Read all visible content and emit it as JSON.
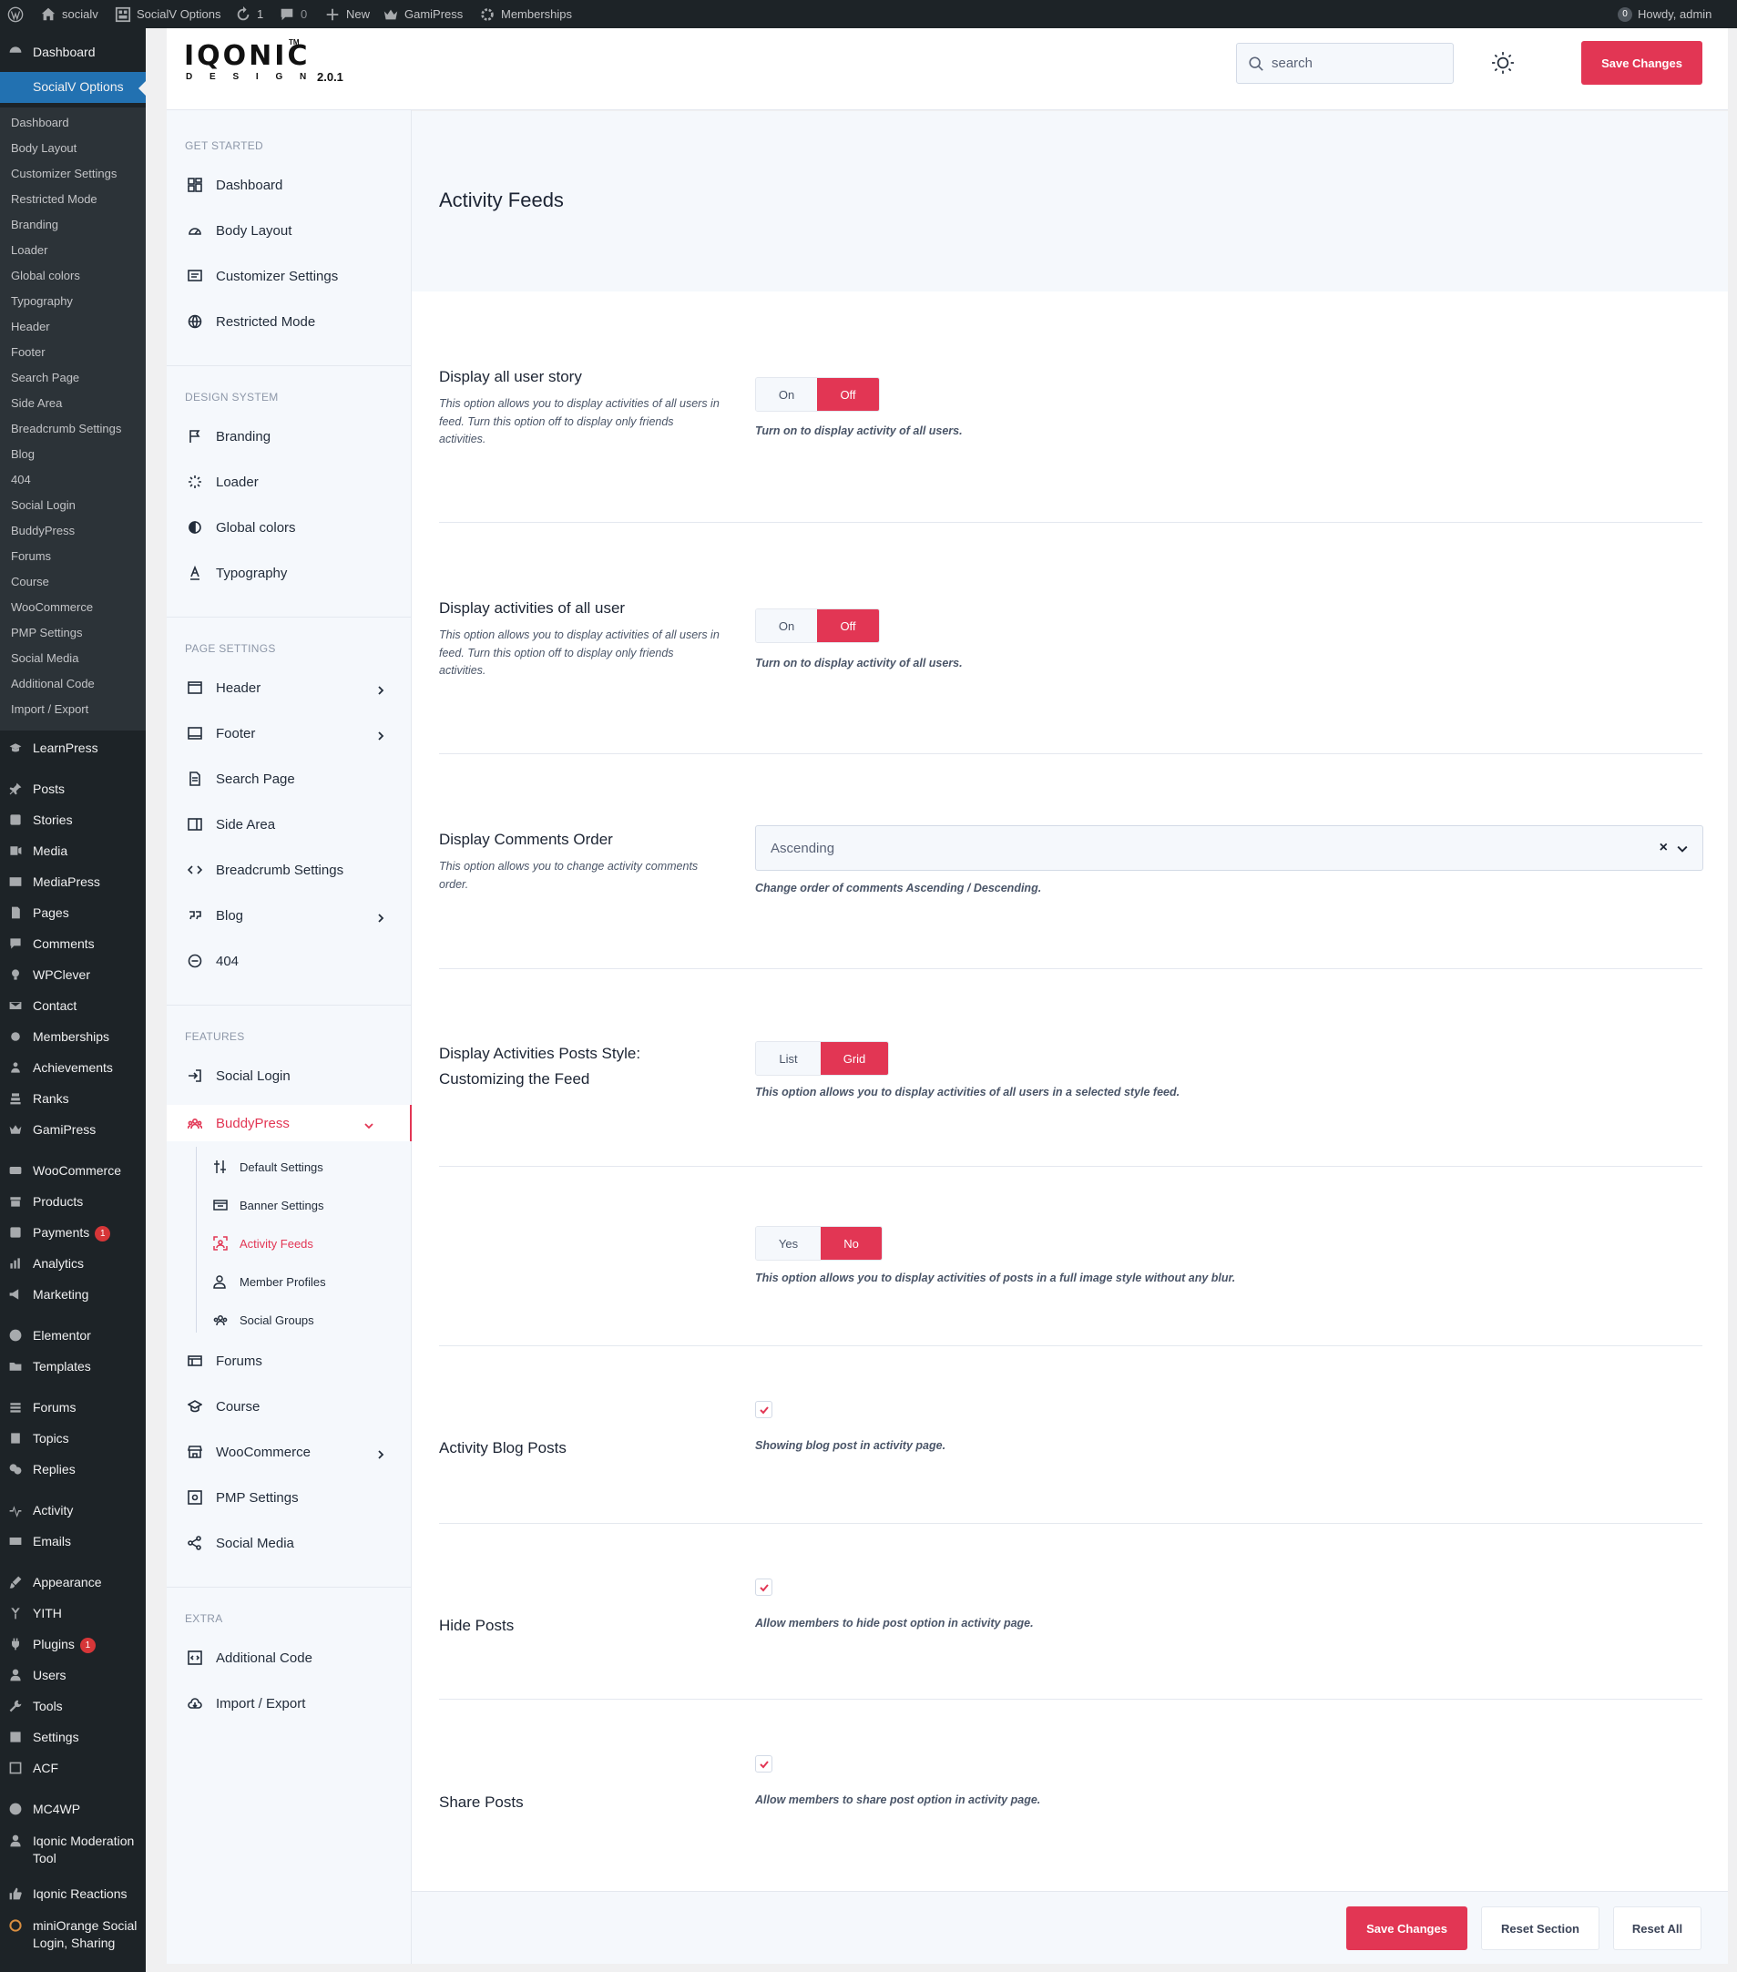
{
  "adminbar": {
    "site": "socialv",
    "options": "SocialV Options",
    "updates": "1",
    "comments": "0",
    "new": "New",
    "gamipress": "GamiPress",
    "memberships": "Memberships",
    "howdy": "Howdy, admin"
  },
  "wpmenu": {
    "dashboard": "Dashboard",
    "socialv_options": "SocialV Options",
    "sub": [
      "Dashboard",
      "Body Layout",
      "Customizer Settings",
      "Restricted Mode",
      "Branding",
      "Loader",
      "Global colors",
      "Typography",
      "Header",
      "Footer",
      "Search Page",
      "Side Area",
      "Breadcrumb Settings",
      "Blog",
      "404",
      "Social Login",
      "BuddyPress",
      "Forums",
      "Course",
      "WooCommerce",
      "PMP Settings",
      "Social Media",
      "Additional Code",
      "Import / Export"
    ],
    "items": [
      "LearnPress",
      "Posts",
      "Stories",
      "Media",
      "MediaPress",
      "Pages",
      "Comments",
      "WPClever",
      "Contact",
      "Memberships",
      "Achievements",
      "Ranks",
      "GamiPress",
      "WooCommerce",
      "Products",
      "Payments",
      "Analytics",
      "Marketing",
      "Elementor",
      "Templates",
      "Forums",
      "Topics",
      "Replies",
      "Activity",
      "Emails",
      "Appearance",
      "YITH",
      "Plugins",
      "Users",
      "Tools",
      "Settings",
      "ACF",
      "MC4WP",
      "Iqonic Moderation Tool",
      "Iqonic Reactions",
      "miniOrange Social Login, Sharing"
    ],
    "payments_badge": "1",
    "plugins_badge": "1"
  },
  "logo": {
    "brand": "IQONIC",
    "design": "D E S I G N",
    "tm": "TM",
    "version": "2.0.1"
  },
  "panel": {
    "sections": {
      "get_started": "GET STARTED",
      "design_system": "DESIGN SYSTEM",
      "page_settings": "PAGE SETTINGS",
      "features": "FEATURES",
      "extra": "EXTRA"
    },
    "nav": {
      "dashboard": "Dashboard",
      "body_layout": "Body Layout",
      "customizer": "Customizer Settings",
      "restricted": "Restricted Mode",
      "branding": "Branding",
      "loader": "Loader",
      "global_colors": "Global colors",
      "typography": "Typography",
      "header": "Header",
      "footer": "Footer",
      "search_page": "Search Page",
      "side_area": "Side Area",
      "breadcrumb": "Breadcrumb Settings",
      "blog": "Blog",
      "p404": "404",
      "social_login": "Social Login",
      "buddypress": "BuddyPress",
      "forums": "Forums",
      "course": "Course",
      "woocommerce": "WooCommerce",
      "pmp": "PMP Settings",
      "social_media": "Social Media",
      "additional_code": "Additional Code",
      "import_export": "Import / Export"
    },
    "bp_sub": {
      "default": "Default Settings",
      "banner": "Banner Settings",
      "activity": "Activity Feeds",
      "member": "Member Profiles",
      "groups": "Social Groups"
    }
  },
  "topbar": {
    "search_placeholder": "search",
    "save": "Save Changes"
  },
  "page_title": "Activity Feeds",
  "rows": {
    "r1": {
      "title": "Display all user story",
      "desc": "This option allows you to display activities of all users in feed. Turn this option off to display only friends activities.",
      "on": "On",
      "off": "Off",
      "hint": "Turn on to display activity of all users."
    },
    "r2": {
      "title": "Display activities of all user",
      "desc": "This option allows you to display activities of all users in feed. Turn this option off to display only friends activities.",
      "on": "On",
      "off": "Off",
      "hint": "Turn on to display activity of all users."
    },
    "r3": {
      "title": "Display Comments Order",
      "desc": "This option allows you to change activity comments order.",
      "value": "Ascending",
      "clear": "×",
      "hint": "Change order of comments Ascending / Descending."
    },
    "r4": {
      "title": "Display Activities Posts Style: Customizing the Feed",
      "list": "List",
      "grid": "Grid",
      "hint": "This option allows you to display activities of all users in a selected style feed."
    },
    "r5": {
      "yes": "Yes",
      "no": "No",
      "hint": "This option allows you to display activities of posts in a full image style without any blur."
    },
    "r6": {
      "title": "Activity Blog Posts",
      "hint": "Showing blog post in activity page."
    },
    "r7": {
      "title": "Hide Posts",
      "hint": "Allow members to hide post option in activity page."
    },
    "r8": {
      "title": "Share Posts",
      "hint": "Allow members to share post option in activity page."
    }
  },
  "footer": {
    "save": "Save Changes",
    "reset_section": "Reset Section",
    "reset_all": "Reset All"
  },
  "colors": {
    "accent": "#e23654",
    "wp_dark": "#1d2327",
    "wp_blue": "#2271b1"
  }
}
